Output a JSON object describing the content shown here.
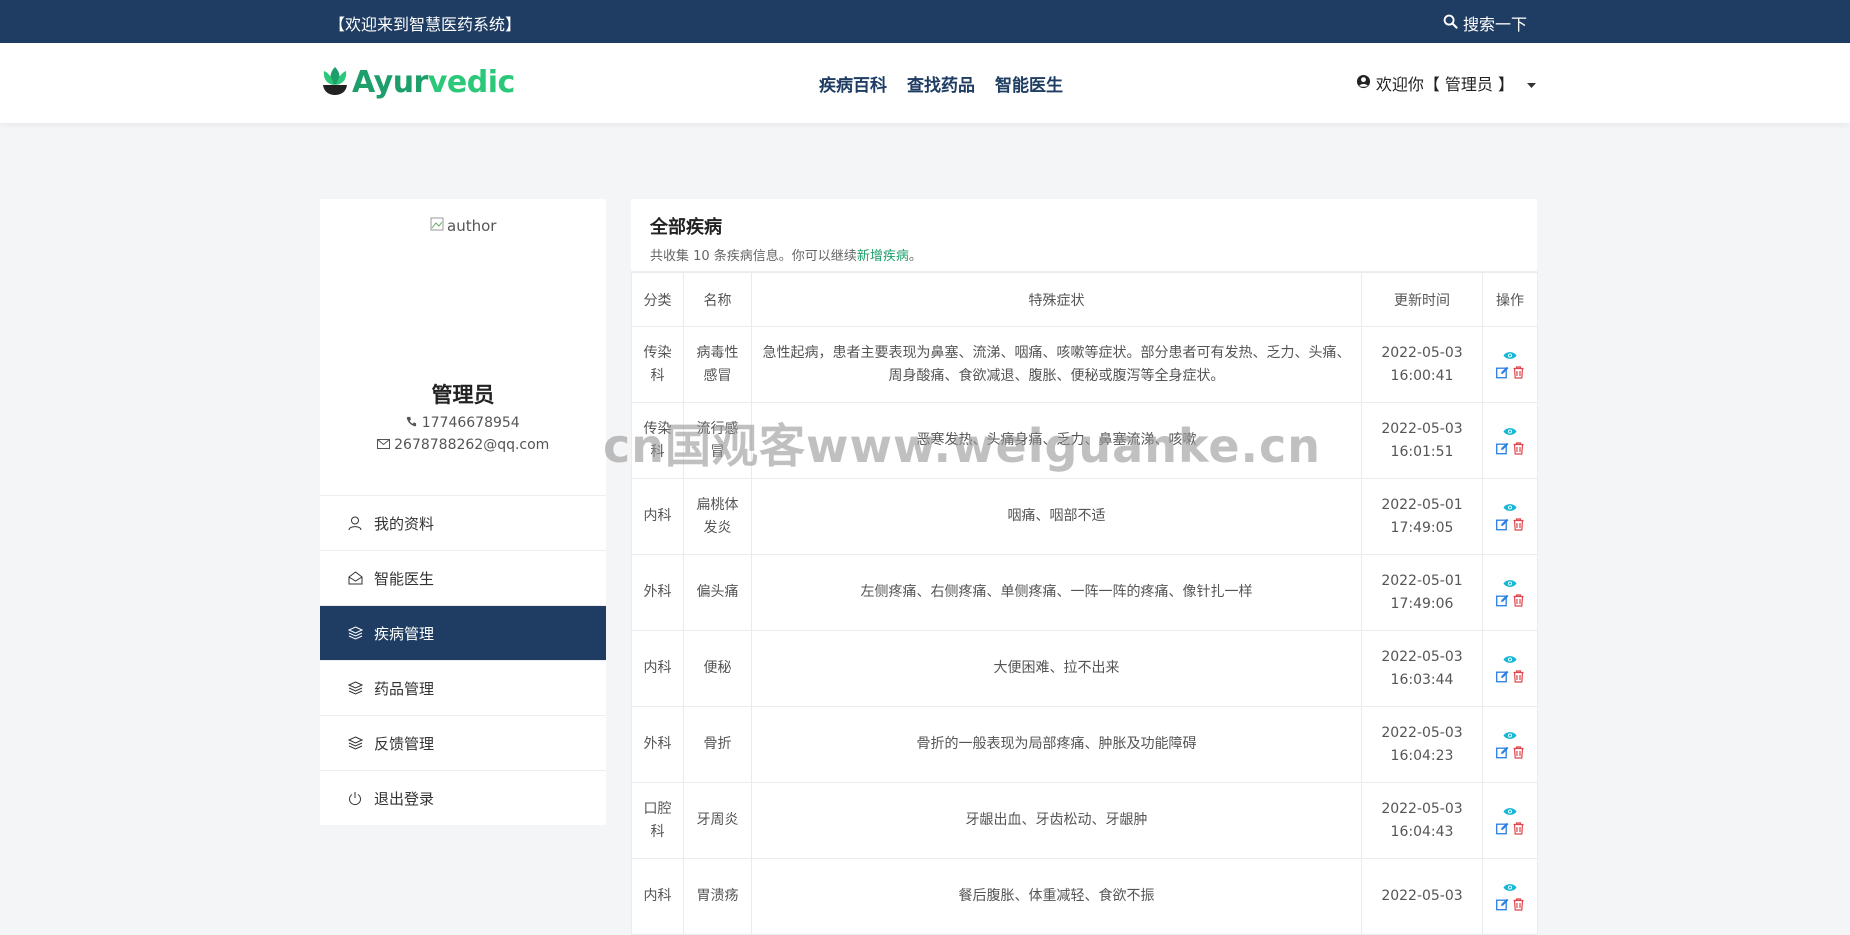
{
  "topbar": {
    "welcome": "【欢迎来到智慧医药系统】",
    "search_label": "搜索一下"
  },
  "navbar": {
    "logo_part1": "Ayur",
    "logo_part2": "vedic",
    "links": [
      "疾病百科",
      "查找药品",
      "智能医生"
    ],
    "user_label": "欢迎你【 管理员 】"
  },
  "profile": {
    "image_alt": "author",
    "name": "管理员",
    "phone": "17746678954",
    "email": "2678788262@qq.com"
  },
  "menu": [
    {
      "label": "我的资料",
      "icon": "user-icon"
    },
    {
      "label": "智能医生",
      "icon": "envelope-open-icon"
    },
    {
      "label": "疾病管理",
      "icon": "layers-icon",
      "active": true
    },
    {
      "label": "药品管理",
      "icon": "layers-icon"
    },
    {
      "label": "反馈管理",
      "icon": "layers-icon"
    },
    {
      "label": "退出登录",
      "icon": "power-icon"
    }
  ],
  "content": {
    "title": "全部疾病",
    "sub_prefix": "共收集 10 条疾病信息。你可以继续",
    "sub_link": "新增疾病",
    "sub_suffix": "。",
    "columns": [
      "分类",
      "名称",
      "特殊症状",
      "更新时间",
      "操作"
    ],
    "rows": [
      {
        "category": "传染科",
        "name": "病毒性感冒",
        "symptoms": "急性起病，患者主要表现为鼻塞、流涕、咽痛、咳嗽等症状。部分患者可有发热、乏力、头痛、周身酸痛、食欲减退、腹胀、便秘或腹泻等全身症状。",
        "date": "2022-05-03",
        "time": "16:00:41"
      },
      {
        "category": "传染科",
        "name": "流行感冒",
        "symptoms": "恶寒发热、头痛身痛、乏力、鼻塞流涕、咳嗽",
        "date": "2022-05-03",
        "time": "16:01:51"
      },
      {
        "category": "内科",
        "name": "扁桃体发炎",
        "symptoms": "咽痛、咽部不适",
        "date": "2022-05-01",
        "time": "17:49:05"
      },
      {
        "category": "外科",
        "name": "偏头痛",
        "symptoms": "左侧疼痛、右侧疼痛、单侧疼痛、一阵一阵的疼痛、像针扎一样",
        "date": "2022-05-01",
        "time": "17:49:06"
      },
      {
        "category": "内科",
        "name": "便秘",
        "symptoms": "大便困难、拉不出来",
        "date": "2022-05-03",
        "time": "16:03:44"
      },
      {
        "category": "外科",
        "name": "骨折",
        "symptoms": "骨折的一般表现为局部疼痛、肿胀及功能障碍",
        "date": "2022-05-03",
        "time": "16:04:23"
      },
      {
        "category": "口腔科",
        "name": "牙周炎",
        "symptoms": "牙龈出血、牙齿松动、牙龈肿",
        "date": "2022-05-03",
        "time": "16:04:43"
      },
      {
        "category": "内科",
        "name": "胃溃疡",
        "symptoms": "餐后腹胀、体重减轻、食欲不振",
        "date": "2022-05-03",
        "time": ""
      }
    ]
  },
  "watermark": "cn国观客www.weiguanke.cn",
  "colors": {
    "brand_dark": "#1f3d63",
    "brand_green": "#1e9e6a",
    "view_icon": "#17b8d6",
    "edit_icon": "#2a7de1",
    "delete_icon": "#e0454f"
  }
}
